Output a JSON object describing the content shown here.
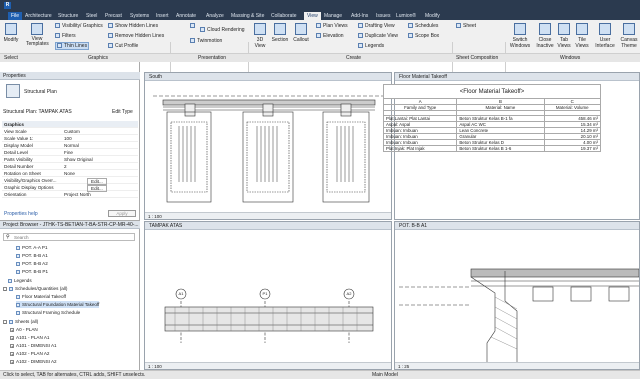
{
  "app": {
    "logo": "R",
    "file_tab": "File",
    "tabs": [
      "Architecture",
      "Structure",
      "Steel",
      "Precast",
      "Systems",
      "Insert",
      "Annotate",
      "Analyze",
      "Massing & Site",
      "Collaborate",
      "View",
      "Manage",
      "Add-Ins",
      "Issues",
      "Lumion®",
      "Modify"
    ],
    "active_tab": "View"
  },
  "ribbon": {
    "modify": "Modify",
    "view_templates": "View\nTemplates",
    "visibility_graphics": "Visibility/ Graphics",
    "filters": "Filters",
    "thin_lines": "Thin Lines",
    "show_hidden_lines": "Show Hidden Lines",
    "remove_hidden_lines": "Remove Hidden Lines",
    "cut_profile": "Cut Profile",
    "render": "Render",
    "render_cloud": "Render in Cloud",
    "render_gallery": "Render Gallery",
    "cloud_rendering": "Cloud Rendering",
    "twinmotion": "Twinmotion",
    "view_3d": "3D View",
    "section": "Section",
    "callout": "Callout",
    "plan_views": "Plan Views",
    "elevation": "Elevation",
    "drafting_view": "Drafting View",
    "duplicate_view": "Duplicate View",
    "legends": "Legends",
    "schedules": "Schedules",
    "scope_box": "Scope Box",
    "sheet": "Sheet",
    "switch_windows": "Switch Windows",
    "close_inactive": "Close Inactive",
    "tab_views": "Tab Views",
    "tile_views": "Tile Views",
    "user_interface": "User Interface",
    "canvas_theme": "Canvas Theme",
    "groups": [
      "Select",
      "Graphics",
      "Presentation",
      "Create",
      "Sheet Composition",
      "Windows"
    ]
  },
  "properties": {
    "title": "Properties",
    "type_name": "Structural Plan",
    "instance": "Structural Plan: TAMPAK ATAS",
    "edit_type": "Edit Type",
    "group_graphics": "Graphics",
    "rows": [
      {
        "k": "View Scale",
        "v": "Custom"
      },
      {
        "k": "Scale Value 1:",
        "v": "100"
      },
      {
        "k": "Display Model",
        "v": "Normal"
      },
      {
        "k": "Detail Level",
        "v": "Fine"
      },
      {
        "k": "Parts Visibility",
        "v": "Show Original"
      },
      {
        "k": "Detail Number",
        "v": "2"
      },
      {
        "k": "Rotation on Sheet",
        "v": "None"
      },
      {
        "k": "Visibility/Graphics Overr...",
        "v": "Edit..."
      },
      {
        "k": "Graphic Display Options",
        "v": "Edit..."
      },
      {
        "k": "Orientation",
        "v": "Project North"
      }
    ],
    "help": "Properties help",
    "apply": "Apply"
  },
  "browser": {
    "title": "Project Browser - JTHK-TS-BETIAN-T-BA-STR-CP-MR-40-...",
    "search_placeholder": "Search",
    "items": [
      "POT. A-A P1",
      "POT. B-B A1",
      "POT. B-B A2",
      "POT. B-B P1",
      "Legends",
      "Schedules/Quantities (all)",
      "Floor Material Takeoff",
      "Structural Foundation Material Takeoff",
      "Structural Framing Schedule",
      "Sheets (all)",
      "A0 - PLAN",
      "A101 - PLAN A1",
      "A101 - DIMENSI A1",
      "A102 - PLAN A2",
      "A102 - DIMENSI A2"
    ]
  },
  "views": {
    "south": {
      "title": "South",
      "scale": "1 : 100"
    },
    "tampak": {
      "title": "TAMPAK ATAS",
      "scale": "1 : 100",
      "grid": [
        "A1",
        "P1",
        "A2"
      ]
    },
    "schedule": {
      "tab": "Floor Material Takeoff",
      "title": "<Floor Material Takeoff>",
      "cols": [
        "A",
        "B",
        "C"
      ],
      "headers": [
        "Family and Type",
        "Material: Name",
        "Material: Volume"
      ],
      "rows": [
        [
          "Plat Lantai: Plat Lantai",
          "Beton Struktur Kelas B-1 fa",
          "458.46 m³"
        ],
        [
          "Aspal: Aspal",
          "Aspal AC WC",
          "15.34 m³"
        ],
        [
          "Imbuan: Imbuan",
          "Lean Concrete",
          "14.29 m³"
        ],
        [
          "Imbuan: Imbuan",
          "Granular",
          "20.10 m³"
        ],
        [
          "Imbuan: Imbuan",
          "Beton Struktur Kelas D",
          "4.00 m³"
        ],
        [
          "Plat Injak: Plat Injak",
          "Beton Struktur Kelas B 1-6",
          "19.37 m³"
        ]
      ]
    },
    "pot": {
      "title": "POT. B-B A1",
      "scale": "1 : 25"
    }
  },
  "status": {
    "text": "Click to select, TAB for alternates, CTRL adds, SHIFT unselects.",
    "model": "Main Model"
  },
  "colors": {
    "ribbon_bg": "#f0f0f0",
    "title_bg": "#2b3a4f",
    "accent": "#1f5fb0"
  }
}
